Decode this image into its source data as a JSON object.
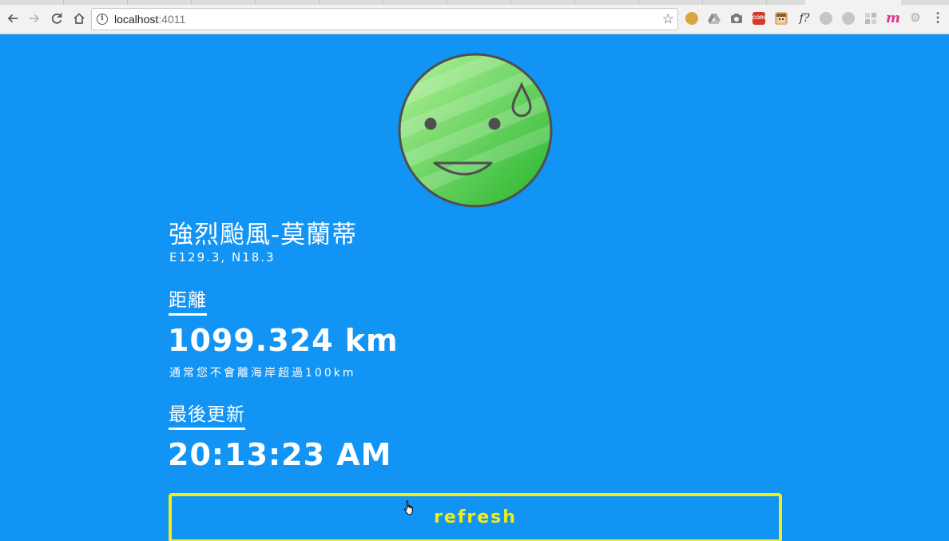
{
  "browser": {
    "url_host": "localhost",
    "url_port": ":4011",
    "back_icon": "arrow-left-icon",
    "forward_icon": "arrow-right-icon",
    "reload_icon": "reload-icon",
    "home_icon": "home-icon",
    "info_icon": "info-icon",
    "bookmark_icon": "star-icon",
    "extensions": [
      {
        "name": "cookie-icon",
        "glyph": "",
        "color": "#d9a441"
      },
      {
        "name": "drive-icon",
        "glyph": "",
        "color": "#9a9a9a"
      },
      {
        "name": "camera-icon",
        "glyph": "",
        "color": "#7a7a7a"
      },
      {
        "name": "cors-icon",
        "glyph": "CORS",
        "color": "#d63a2a"
      },
      {
        "name": "face-extension-icon",
        "glyph": "",
        "color": "#e0b07a"
      },
      {
        "name": "f-question-icon",
        "glyph": "f?",
        "color": "#f2f2f2"
      },
      {
        "name": "grey-circle-icon",
        "glyph": "",
        "color": "#c6c6c6"
      },
      {
        "name": "grey-leaf-icon",
        "glyph": "",
        "color": "#c6c6c6"
      },
      {
        "name": "grid-icon",
        "glyph": "",
        "color": "#d4d4d4"
      },
      {
        "name": "m-extension-icon",
        "glyph": "m",
        "color": "#f2f2f2"
      },
      {
        "name": "gear-icon",
        "glyph": "",
        "color": "#c6c6c6"
      }
    ],
    "menu_icon": "kebab-menu-icon"
  },
  "status": {
    "face_icon": "sweating-smile-face-icon",
    "face_color": "#4dcb4a",
    "typhoon_name": "強烈颱風-莫蘭蒂",
    "coordinates": "E129.3, N18.3"
  },
  "distance": {
    "label": "距離",
    "value": "1099.324 km",
    "note": "通常您不會離海岸超過100km"
  },
  "updated": {
    "label": "最後更新",
    "value": "20:13:23 AM"
  },
  "actions": {
    "refresh_label": "refresh"
  },
  "colors": {
    "background": "#1194f4",
    "accent": "#f5ec12"
  }
}
